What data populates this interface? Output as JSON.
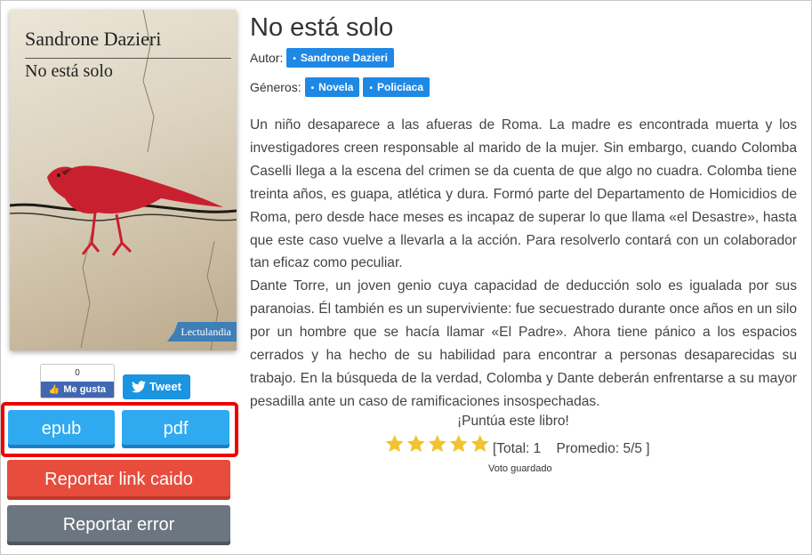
{
  "book": {
    "title": "No está solo",
    "author_label": "Autor:",
    "author": "Sandrone Dazieri",
    "genres_label": "Géneros:",
    "genres": [
      "Novela",
      "Policíaca"
    ],
    "synopsis": [
      "Un niño desaparece a las afueras de Roma. La madre es encontrada muerta y los investigadores creen responsable al marido de la mujer. Sin embargo, cuando Colomba Caselli llega a la escena del crimen se da cuenta de que algo no cuadra. Colomba tiene treinta años, es guapa, atlética y dura. Formó parte del Departamento de Homicidios de Roma, pero desde hace meses es incapaz de superar lo que llama «el Desastre», hasta que este caso vuelve a llevarla a la acción. Para resolverlo contará con un colaborador tan eficaz como peculiar.",
      "Dante Torre, un joven genio cuya capacidad de deducción solo es igualada por sus paranoias. Él también es un superviviente: fue secuestrado durante once años en un silo por un hombre que se hacía llamar «El Padre». Ahora tiene pánico a los espacios cerrados y ha hecho de su habilidad para encontrar a personas desaparecidas su trabajo. En la búsqueda de la verdad, Colomba y Dante deberán enfrentarse a su mayor pesadilla ante un caso de ramificaciones insospechadas."
    ]
  },
  "cover": {
    "author": "Sandrone Dazieri",
    "title": "No está solo",
    "badge": "Lectulandia"
  },
  "social": {
    "like_count": "0",
    "like_label": "Me gusta",
    "tweet_label": "Tweet"
  },
  "downloads": {
    "epub": "epub",
    "pdf": "pdf"
  },
  "actions": {
    "report_link": "Reportar link caido",
    "report_error": "Reportar error"
  },
  "rating": {
    "prompt": "¡Puntúa este libro!",
    "stars": 5,
    "max_stars": 5,
    "total": "[Total: 1    Promedio: 5/5 ]",
    "saved": "Voto guardado"
  },
  "colors": {
    "download_button": "#2faaf0",
    "highlight_border": "#ee0000",
    "report_link": "#e84c3d",
    "report_error": "#6c7680",
    "tag": "#1e88e5",
    "star": "#f2c331"
  }
}
